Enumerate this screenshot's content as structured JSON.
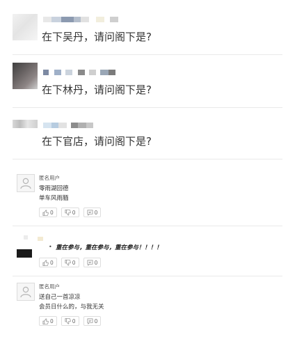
{
  "posts": [
    {
      "text": "在下吴丹，请问阁下是?"
    },
    {
      "text": "在下林丹，请问阁下是?"
    },
    {
      "text": "在下官店，请问阁下是?"
    }
  ],
  "comments": [
    {
      "user": "匿名用户",
      "lines": [
        "零雨湖回德",
        "单车风雨腼"
      ],
      "likes": "0",
      "dislikes": "0",
      "replies": "0"
    },
    {
      "user": "",
      "lines": [
        "重在参与，重在参与，重在参与！！！！"
      ],
      "likes": "0",
      "dislikes": "0",
      "replies": "0"
    },
    {
      "user": "匿名用户",
      "lines": [
        "送自己一首凉凉",
        "会员日什么的，与我无关"
      ],
      "likes": "0",
      "dislikes": "0",
      "replies": "0"
    }
  ],
  "icons": {
    "like": "thumbs-up-icon",
    "dislike": "thumbs-down-icon",
    "reply": "comment-icon",
    "avatar": "user-icon"
  }
}
